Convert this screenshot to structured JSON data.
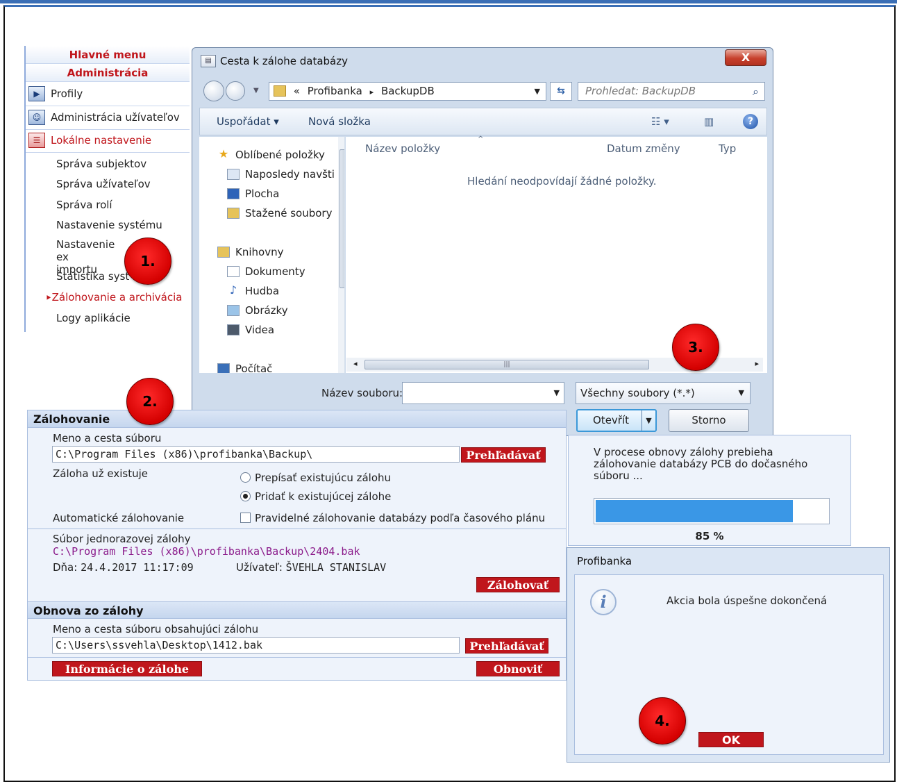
{
  "menu": {
    "header1": "Hlavné menu",
    "header2": "Administrácia",
    "items": [
      {
        "label": "Profily",
        "icon": "profiles-icon"
      },
      {
        "label": "Administrácia užívateľov",
        "icon": "user-admin-icon"
      },
      {
        "label": "Lokálne nastavenie",
        "icon": "local-settings-icon"
      }
    ],
    "subitems": [
      "Správa subjektov",
      "Správa užívateľov",
      "Správa rolí",
      "Nastavenie systému",
      "Nastavenie exportu a importu",
      "Štatistika systému",
      "Zálohovanie a archivácia",
      "Logy aplikácie"
    ],
    "sub_line1": "Nastavenie ex",
    "sub_line1b": "a",
    "sub_line2": "importu",
    "stat_visible": "Štatistika syst",
    "active_prefix": "⯈"
  },
  "file_dialog": {
    "title": "Cesta k zálohe databázy",
    "close": "X",
    "address": {
      "chevrons": "«",
      "part1": "Profibanka",
      "sep": "▸",
      "part2": "BackupDB"
    },
    "search_placeholder": "Prohledat: BackupDB",
    "toolbar": {
      "organize": "Uspořádat ▾",
      "new_folder": "Nová složka"
    },
    "nav": {
      "favorites": "Oblíbené položky",
      "recent": "Naposledy navšti",
      "desktop": "Plocha",
      "downloads": "Stažené soubory",
      "libraries": "Knihovny",
      "documents": "Dokumenty",
      "music": "Hudba",
      "pictures": "Obrázky",
      "videos": "Videa",
      "computer": "Počítač"
    },
    "columns": {
      "name": "Název položky",
      "date": "Datum změny",
      "type": "Typ"
    },
    "empty_message": "Hledání neodpovídají žádné položky.",
    "filename_label": "Název souboru:",
    "filename_value": "",
    "filetype": "Všechny soubory (*.*)",
    "open": "Otevřít",
    "cancel": "Storno"
  },
  "backup": {
    "title": "Zálohovanie",
    "path_label": "Meno a cesta súboru",
    "path_value": "C:\\Program Files (x86)\\profibanka\\Backup\\",
    "browse": "Prehľadávať",
    "exists_label": "Záloha už existuje",
    "radio_overwrite": "Prepísať existujúcu zálohu",
    "radio_append": "Pridať k existujúcej zálohe",
    "auto_label": "Automatické zálohovanie",
    "auto_check": "Pravidelné zálohovanie databázy podľa časového plánu",
    "single_label": "Súbor jednorazovej zálohy",
    "single_path": "C:\\Program Files (x86)\\profibanka\\Backup\\2404.bak",
    "date_label": "Dňa:",
    "date_value": "24.4.2017 11:17:09",
    "user_label": "Užívateľ:",
    "user_value": "ŠVEHLA STANISLAV",
    "backup_btn": "Zálohovať"
  },
  "restore": {
    "title": "Obnova zo zálohy",
    "path_label": "Meno a cesta súboru obsahujúci zálohu",
    "path_value": "C:\\Users\\ssvehla\\Desktop\\1412.bak",
    "browse": "Prehľadávať",
    "info_btn": "Informácie o zálohe",
    "restore_btn": "Obnoviť"
  },
  "progress": {
    "text": "V procese obnovy zálohy prebieha zálohovanie databázy PCB do dočasného súboru ...",
    "percent_value": 85,
    "percent_label": "85 %"
  },
  "message": {
    "title": "Profibanka",
    "text": "Akcia bola úspešne dokončená",
    "ok": "OK"
  },
  "markers": [
    "1.",
    "2.",
    "3.",
    "4."
  ],
  "colors": {
    "accent_red": "#c0161c",
    "progress_blue": "#3a97e6",
    "frame_blue": "#3b6fb6"
  }
}
